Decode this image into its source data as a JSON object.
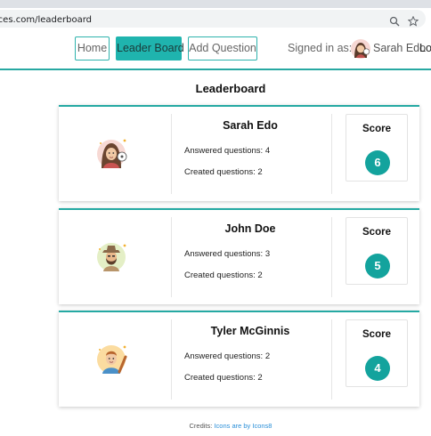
{
  "browser": {
    "url_visible": "spaces.com/leaderboard",
    "zoom_icon": "zoom-icon",
    "star_icon": "star-icon"
  },
  "nav": {
    "home": "Home",
    "leaderboard": "Leader Board",
    "add_question": "Add Question",
    "signed_in_label": "Signed in as:",
    "user_name": "Sarah Edo",
    "logout_partial": "Lo"
  },
  "page": {
    "title": "Leaderboard",
    "score_label": "Score",
    "answered_prefix": "Answered questions:",
    "created_prefix": "Created questions:"
  },
  "users": [
    {
      "name": "Sarah Edo",
      "answered": "Answered questions: 4",
      "created": "Created questions: 2",
      "score": "6",
      "avatar": "woman-avatar-icon"
    },
    {
      "name": "John Doe",
      "answered": "Answered questions: 3",
      "created": "Created questions: 2",
      "score": "5",
      "avatar": "bearded-man-hat-avatar-icon"
    },
    {
      "name": "Tyler McGinnis",
      "answered": "Answered questions: 2",
      "created": "Created questions: 2",
      "score": "4",
      "avatar": "man-with-bat-avatar-icon"
    }
  ],
  "footer": {
    "credits_label": "Credits:",
    "credits_link": "Icons are by Icons8"
  },
  "colors": {
    "accent": "#1fb4ae",
    "badge": "#13a39d",
    "link": "#2a8fd8"
  }
}
